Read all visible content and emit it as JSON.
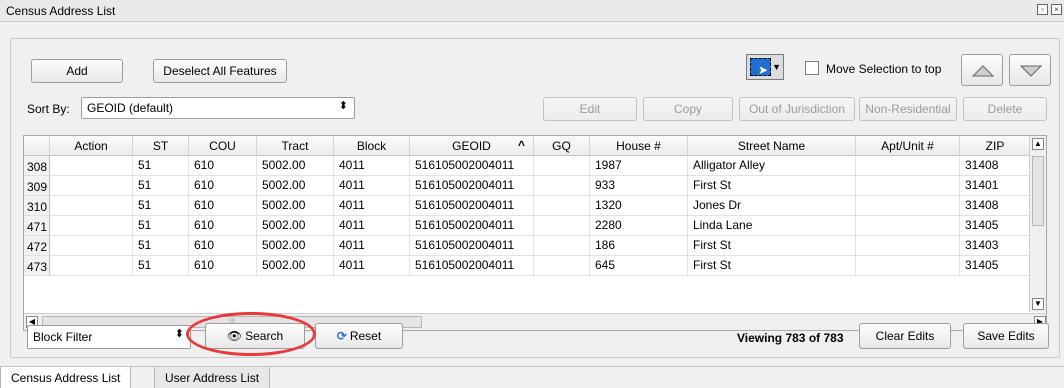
{
  "window": {
    "title": "Census Address List"
  },
  "toolbar": {
    "add_label": "Add",
    "deselect_label": "Deselect All Features",
    "move_selection_label": "Move Selection to top",
    "sort_by_label": "Sort By:",
    "sort_by_value": "GEOID (default)",
    "edit_label": "Edit",
    "copy_label": "Copy",
    "out_of_jurisdiction_label": "Out of Jurisdiction",
    "non_residential_label": "Non-Residential",
    "delete_label": "Delete"
  },
  "table": {
    "columns": [
      "Action",
      "ST",
      "COU",
      "Tract",
      "Block",
      "GEOID",
      "GQ",
      "House #",
      "Street Name",
      "Apt/Unit #",
      "ZIP"
    ],
    "sort_indicator": "^",
    "rows": [
      {
        "id": "308",
        "cells": [
          "",
          "51",
          "610",
          "5002.00",
          "4011",
          "516105002004011",
          "",
          "1987",
          "Alligator Alley",
          "",
          "31408"
        ]
      },
      {
        "id": "309",
        "cells": [
          "",
          "51",
          "610",
          "5002.00",
          "4011",
          "516105002004011",
          "",
          "933",
          "First St",
          "",
          "31401"
        ]
      },
      {
        "id": "310",
        "cells": [
          "",
          "51",
          "610",
          "5002.00",
          "4011",
          "516105002004011",
          "",
          "1320",
          "Jones Dr",
          "",
          "31408"
        ]
      },
      {
        "id": "471",
        "cells": [
          "",
          "51",
          "610",
          "5002.00",
          "4011",
          "516105002004011",
          "",
          "2280",
          "Linda Lane",
          "",
          "31405"
        ]
      },
      {
        "id": "472",
        "cells": [
          "",
          "51",
          "610",
          "5002.00",
          "4011",
          "516105002004011",
          "",
          "186",
          "First St",
          "",
          "31403"
        ]
      },
      {
        "id": "473",
        "cells": [
          "",
          "51",
          "610",
          "5002.00",
          "4011",
          "516105002004011",
          "",
          "645",
          "First St",
          "",
          "31405"
        ]
      }
    ]
  },
  "bottom": {
    "filter_value": "Block Filter",
    "search_label": "Search",
    "reset_label": "Reset",
    "viewing_text": "Viewing 783 of 783",
    "clear_edits_label": "Clear Edits",
    "save_edits_label": "Save Edits"
  },
  "tabs": [
    {
      "label": "Census Address List",
      "active": true
    },
    {
      "label": "User Address List",
      "active": false
    }
  ],
  "icons": {
    "search": "binoculars-icon",
    "reset": "refresh-icon",
    "select": "select-features-icon",
    "up": "move-up-icon",
    "down": "move-down-icon"
  },
  "colors": {
    "highlight": "#e83a3a",
    "select_blue": "#1f6fd1",
    "reset_blue": "#2a78d4"
  }
}
